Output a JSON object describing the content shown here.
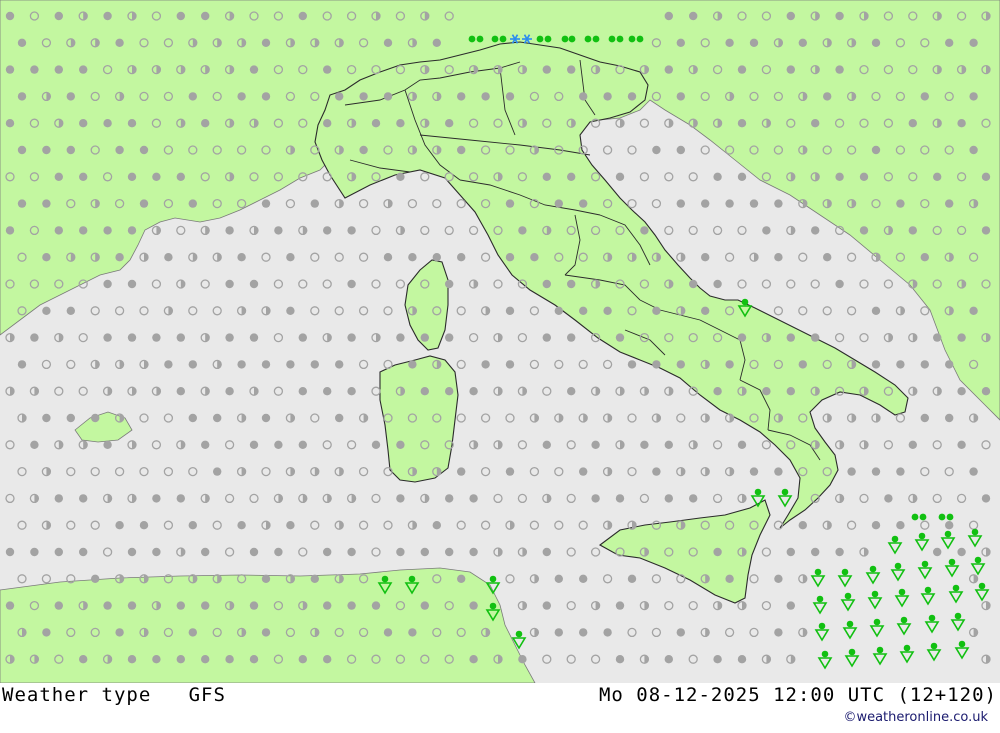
{
  "footer": {
    "title": "Weather type   GFS",
    "datetime": "Mo 08-12-2025 12:00 UTC (12+120)",
    "credit": "©weatheronline.co.uk"
  },
  "colors": {
    "sea": "#e9e9e9",
    "land": "#c3f7a0",
    "border": "#2b2b2b",
    "dot": "#a3a3a3",
    "rain": "#11c011",
    "snow": "#2a8bf0"
  },
  "legend_symbols": [
    "filled-dot-overcast",
    "half-dot-partly-cloudy",
    "open-circle-clear",
    "green-dots-rain",
    "green-triangle-shower",
    "blue-star-snow"
  ]
}
